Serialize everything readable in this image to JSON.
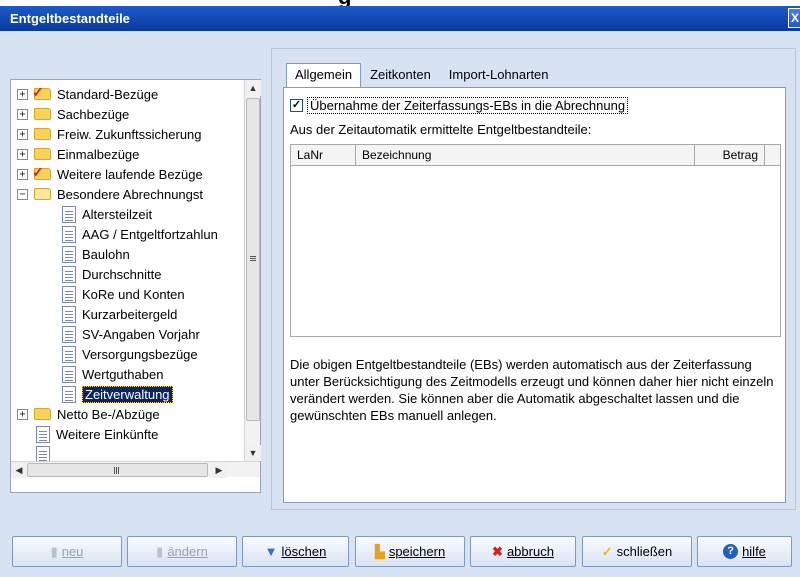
{
  "window": {
    "title": "Entgeltbestandteile",
    "close_symbol": "X"
  },
  "tree": {
    "items": [
      {
        "label": "Standard-Bezüge",
        "expander": "+",
        "icon": "folder-checked-icon"
      },
      {
        "label": "Sachbezüge",
        "expander": "+",
        "icon": "folder-icon"
      },
      {
        "label": "Freiw. Zukunftssicherung",
        "expander": "+",
        "icon": "folder-icon"
      },
      {
        "label": "Einmalbezüge",
        "expander": "+",
        "icon": "folder-icon"
      },
      {
        "label": "Weitere laufende Bezüge",
        "expander": "+",
        "icon": "folder-checked-icon"
      },
      {
        "label": "Besondere Abrechnungst",
        "expander": "−",
        "icon": "folder-open-icon"
      },
      {
        "label": "Altersteilzeit",
        "icon": "document-icon"
      },
      {
        "label": "AAG / Entgeltfortzahlun",
        "icon": "document-icon"
      },
      {
        "label": "Baulohn",
        "icon": "document-icon"
      },
      {
        "label": "Durchschnitte",
        "icon": "document-icon"
      },
      {
        "label": "KoRe und Konten",
        "icon": "document-icon"
      },
      {
        "label": "Kurzarbeitergeld",
        "icon": "document-icon"
      },
      {
        "label": "SV-Angaben Vorjahr",
        "icon": "document-icon"
      },
      {
        "label": "Versorgungsbezüge",
        "icon": "document-icon"
      },
      {
        "label": "Wertguthaben",
        "icon": "document-icon"
      },
      {
        "label": "Zeitverwaltung",
        "icon": "document-icon",
        "selected": true
      },
      {
        "label": "Netto Be-/Abzüge",
        "expander": "+",
        "icon": "folder-icon"
      },
      {
        "label": "Weitere Einkünfte",
        "icon": "document-icon"
      }
    ]
  },
  "tabs": [
    {
      "label": "Allgemein",
      "active": true
    },
    {
      "label": "Zeitkonten",
      "active": false
    },
    {
      "label": "Import-Lohnarten",
      "active": false
    }
  ],
  "general": {
    "checkbox_label": "Übernahme der Zeiterfassungs-EBs in die Abrechnung",
    "checkbox_checked": true,
    "subtitle": "Aus der Zeitautomatik ermittelte Entgeltbestandteile:",
    "table": {
      "columns": [
        "LaNr",
        "Bezeichnung",
        "Betrag"
      ],
      "rows": []
    },
    "info_text": "Die obigen Entgeltbestandteile (EBs) werden automatisch aus der Zeiterfassung unter Berücksichtigung des Zeitmodells erzeugt und können daher hier nicht einzeln verändert werden. Sie können aber die Automatik abgeschaltet lassen und die gewünschten EBs manuell anlegen."
  },
  "toolbar": {
    "buttons": [
      {
        "label": "neu",
        "icon": "new-document-icon",
        "enabled": false
      },
      {
        "label": "ändern",
        "icon": "edit-icon",
        "enabled": false
      },
      {
        "label": "löschen",
        "icon": "delete-icon",
        "enabled": true
      },
      {
        "label": "speichern",
        "icon": "save-icon",
        "enabled": true
      },
      {
        "label": "abbruch",
        "icon": "cancel-icon",
        "enabled": true
      },
      {
        "label": "schließen",
        "icon": "close-check-icon",
        "enabled": true
      },
      {
        "label": "hilfe",
        "icon": "help-icon",
        "enabled": true
      }
    ]
  },
  "colors": {
    "titlebar": "#0a3a9e",
    "window_bg": "#d7e3f3",
    "selection": "#0a246a",
    "folder_check": "#d8241e"
  }
}
